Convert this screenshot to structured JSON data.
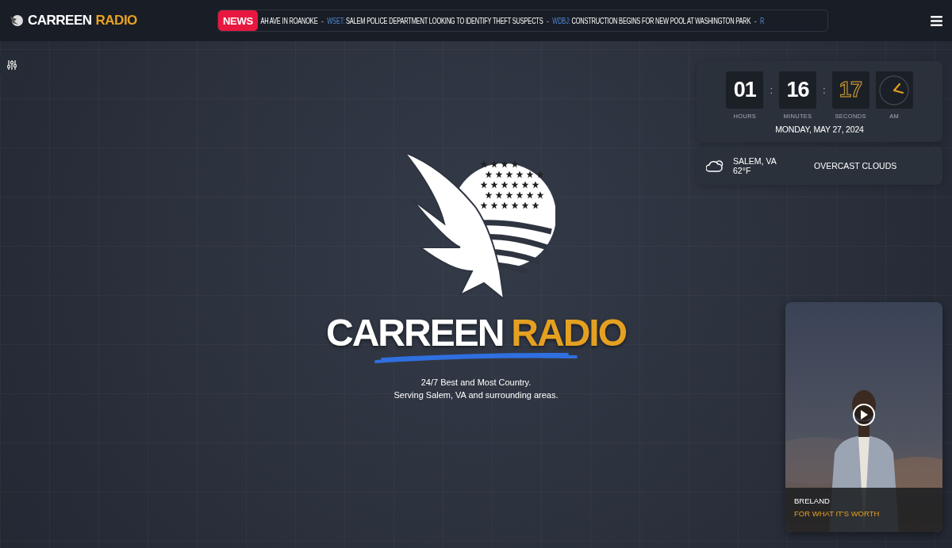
{
  "header": {
    "logo": {
      "name": "CARREEN",
      "accent": "RADIO"
    },
    "ticker": {
      "label": "NEWS",
      "separator": "-",
      "items": [
        {
          "headline": "AH AVE IN ROANOKE"
        },
        {
          "source": "WSET:",
          "headline": "SALEM POLICE DEPARTMENT LOOKING TO IDENTIFY THEFT SUSPECTS"
        },
        {
          "source": "WDBJ:",
          "headline": "CONSTRUCTION BEGINS FOR NEW POOL AT WASHINGTON PARK"
        },
        {
          "source": "R"
        }
      ]
    }
  },
  "hero": {
    "name": "CARREEN",
    "accent": "RADIO",
    "tagline": [
      "24/7 Best and Most Country.",
      "Serving Salem, VA and surrounding areas."
    ]
  },
  "clock": {
    "separator": ":",
    "units": [
      {
        "value": "01",
        "label": "HOURS",
        "kind": "plain"
      },
      {
        "value": "16",
        "label": "MINUTES",
        "kind": "plain"
      },
      {
        "value": "17",
        "label": "SECONDS",
        "kind": "outline"
      }
    ],
    "period": "AM",
    "date": "MONDAY, MAY 27, 2024"
  },
  "weather": {
    "location": "SALEM, VA",
    "temperature": "62°F",
    "condition": "OVERCAST CLOUDS"
  },
  "now_playing": {
    "artist": "BRELAND",
    "title": "FOR WHAT IT'S WORTH"
  }
}
